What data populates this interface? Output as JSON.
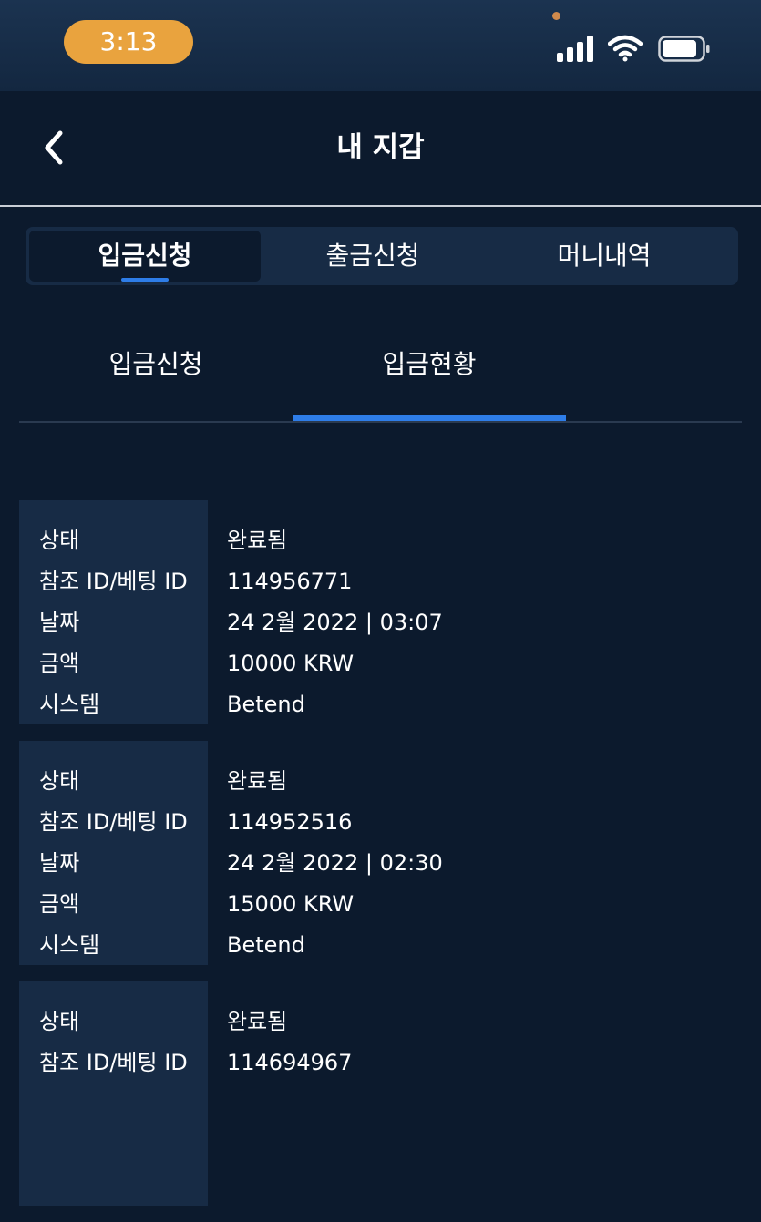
{
  "status_bar": {
    "time": "3:13",
    "icons": [
      "cellular-signal-icon",
      "wifi-icon",
      "battery-icon"
    ]
  },
  "header": {
    "back_icon": "chevron-left-icon",
    "title": "내 지갑"
  },
  "main_tabs": [
    {
      "label": "입금신청",
      "active": true
    },
    {
      "label": "출금신청",
      "active": false
    },
    {
      "label": "머니내역",
      "active": false
    }
  ],
  "sub_tabs": [
    {
      "label": "입금신청",
      "active": false
    },
    {
      "label": "입금현황",
      "active": true
    }
  ],
  "colors": {
    "accent": "#2e7de8",
    "background": "#0c1a2d",
    "panel": "#172b45",
    "time_pill": "#e9a33e"
  },
  "records": [
    {
      "rows": [
        {
          "label": "상태",
          "value": "완료됨"
        },
        {
          "label": "참조 ID/베팅 ID",
          "value": "114956771"
        },
        {
          "label": "날짜",
          "value": "24 2월 2022 | 03:07"
        },
        {
          "label": "금액",
          "value": "10000 KRW"
        },
        {
          "label": "시스템",
          "value": "Betend"
        }
      ]
    },
    {
      "rows": [
        {
          "label": "상태",
          "value": "완료됨"
        },
        {
          "label": "참조 ID/베팅 ID",
          "value": "114952516"
        },
        {
          "label": "날짜",
          "value": "24 2월 2022 | 02:30"
        },
        {
          "label": "금액",
          "value": "15000 KRW"
        },
        {
          "label": "시스템",
          "value": "Betend"
        }
      ]
    },
    {
      "rows": [
        {
          "label": "상태",
          "value": "완료됨"
        },
        {
          "label": "참조 ID/베팅 ID",
          "value": "114694967"
        }
      ]
    }
  ]
}
